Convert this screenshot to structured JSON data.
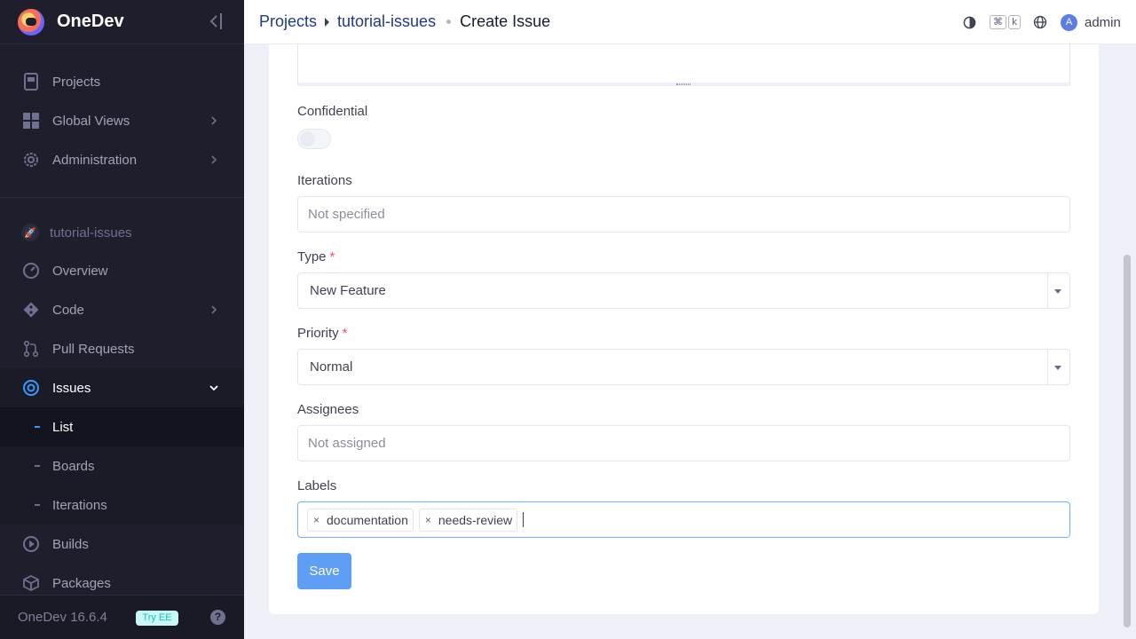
{
  "app": {
    "name": "OneDev",
    "version": "OneDev 16.6.4",
    "try_ee": "Try EE",
    "help": "?"
  },
  "sidebar": {
    "global": [
      {
        "label": "Projects"
      },
      {
        "label": "Global Views"
      },
      {
        "label": "Administration"
      }
    ],
    "project_name": "tutorial-issues",
    "project": [
      {
        "label": "Overview"
      },
      {
        "label": "Code"
      },
      {
        "label": "Pull Requests"
      },
      {
        "label": "Issues"
      },
      {
        "label": "List"
      },
      {
        "label": "Boards"
      },
      {
        "label": "Iterations"
      },
      {
        "label": "Builds"
      },
      {
        "label": "Packages"
      }
    ]
  },
  "header": {
    "breadcrumb": [
      "Projects",
      "tutorial-issues"
    ],
    "current": "Create Issue",
    "kbd_cmd": "⌘",
    "kbd_k": "k",
    "user_initial": "A",
    "user_name": "admin"
  },
  "form": {
    "confidential": {
      "label": "Confidential",
      "on": false
    },
    "iterations": {
      "label": "Iterations",
      "placeholder": "Not specified"
    },
    "type": {
      "label": "Type",
      "required_mark": "*",
      "value": "New Feature"
    },
    "priority": {
      "label": "Priority",
      "required_mark": "*",
      "value": "Normal"
    },
    "assignees": {
      "label": "Assignees",
      "placeholder": "Not assigned"
    },
    "labels": {
      "label": "Labels",
      "tags": [
        "documentation",
        "needs-review"
      ],
      "remove": "×"
    },
    "save_label": "Save"
  },
  "colors": {
    "sidebar_bg": "#1e1e2d",
    "accent": "#3699ff",
    "primary_button": "#5e9ef4",
    "required": "#f64e60"
  }
}
